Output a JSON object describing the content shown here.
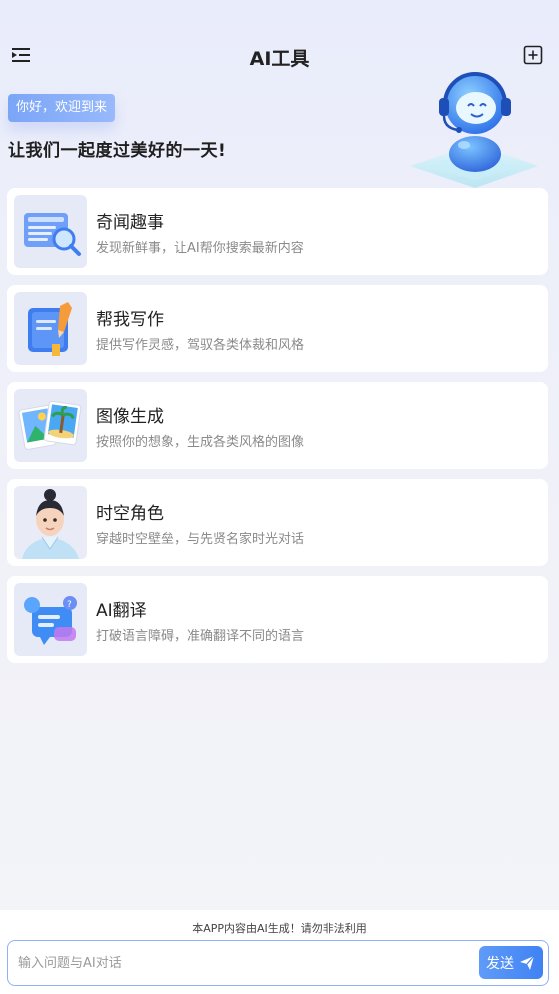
{
  "header": {
    "title": "AI工具",
    "menu_icon": "menu-collapse-icon",
    "add_icon": "plus-square-icon"
  },
  "greeting": {
    "badge": "你好，欢迎到来",
    "title": "让我们一起度过美好的一天!"
  },
  "tools": [
    {
      "name": "奇闻趣事",
      "desc": "发现新鲜事，让AI帮你搜索最新内容",
      "icon": "search-document-icon"
    },
    {
      "name": "帮我写作",
      "desc": "提供写作灵感，驾驭各类体裁和风格",
      "icon": "book-pencil-icon"
    },
    {
      "name": "图像生成",
      "desc": "按照你的想象，生成各类风格的图像",
      "icon": "picture-icon"
    },
    {
      "name": "时空角色",
      "desc": "穿越时空壁垒，与先贤名家时光对话",
      "icon": "character-avatar"
    },
    {
      "name": "AI翻译",
      "desc": "打破语言障碍，准确翻译不同的语言",
      "icon": "chat-translate-icon"
    }
  ],
  "footer": {
    "notice": "本APP内容由AI生成！请勿非法利用",
    "input_placeholder": "输入问题与AI对话",
    "send_label": "发送"
  },
  "colors": {
    "accent": "#4a8af5",
    "badge": "#7ba5f7"
  }
}
